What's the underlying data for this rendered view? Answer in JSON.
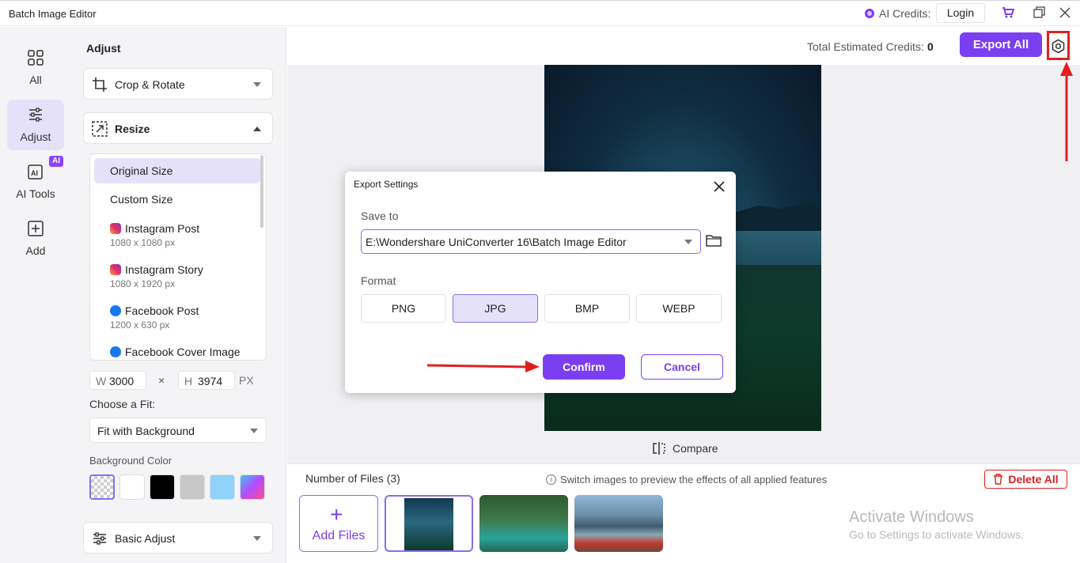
{
  "app": {
    "title": "Batch Image Editor"
  },
  "titlebar": {
    "ai_credits_label": "AI Credits:",
    "login_label": "Login"
  },
  "nav": {
    "items": [
      {
        "label": "All"
      },
      {
        "label": "Adjust"
      },
      {
        "label": "AI Tools",
        "badge": "AI"
      },
      {
        "label": "Add"
      }
    ]
  },
  "panel": {
    "title": "Adjust",
    "crop_rotate": "Crop & Rotate",
    "resize": "Resize",
    "sizes": [
      {
        "label": "Original Size",
        "sub": ""
      },
      {
        "label": "Custom Size",
        "sub": ""
      },
      {
        "label": "Instagram Post",
        "sub": "1080 x 1080 px"
      },
      {
        "label": "Instagram Story",
        "sub": "1080 x 1920 px"
      },
      {
        "label": "Facebook Post",
        "sub": "1200 x 630 px"
      },
      {
        "label": "Facebook Cover Image",
        "sub": ""
      }
    ],
    "width_label": "W",
    "width_value": "3000",
    "times": "×",
    "height_label": "H",
    "height_value": "3974",
    "unit": "PX",
    "fit_label": "Choose a Fit:",
    "fit_value": "Fit with Background",
    "bg_color_label": "Background Color",
    "basic_adjust": "Basic Adjust"
  },
  "topbar": {
    "credits_label": "Total Estimated Credits:",
    "credits_value": "0",
    "export_all": "Export All"
  },
  "compare_label": "Compare",
  "files": {
    "count_label": "Number of Files (3)",
    "hint": "Switch images to preview the effects of all applied features",
    "delete_all": "Delete All",
    "add_files": "Add Files"
  },
  "dialog": {
    "title": "Export Settings",
    "save_to_label": "Save to",
    "path": "E:\\Wondershare UniConverter 16\\Batch Image Editor",
    "format_label": "Format",
    "formats": [
      "PNG",
      "JPG",
      "BMP",
      "WEBP"
    ],
    "selected_format": "JPG",
    "confirm": "Confirm",
    "cancel": "Cancel"
  },
  "watermark": {
    "line1": "Activate Windows",
    "line2": "Go to Settings to activate Windows."
  },
  "colors": {
    "accent": "#7b3ff2",
    "accent_light": "#e6e1fb",
    "annotation_red": "#e02020"
  },
  "icons": [
    "grid-icon",
    "sliders-icon",
    "ai-tools-icon",
    "plus-square-icon",
    "crop-icon",
    "resize-icon",
    "settings-icon",
    "cart-icon",
    "restore-icon",
    "close-icon",
    "folder-icon",
    "compare-icon",
    "trash-icon",
    "info-icon"
  ]
}
